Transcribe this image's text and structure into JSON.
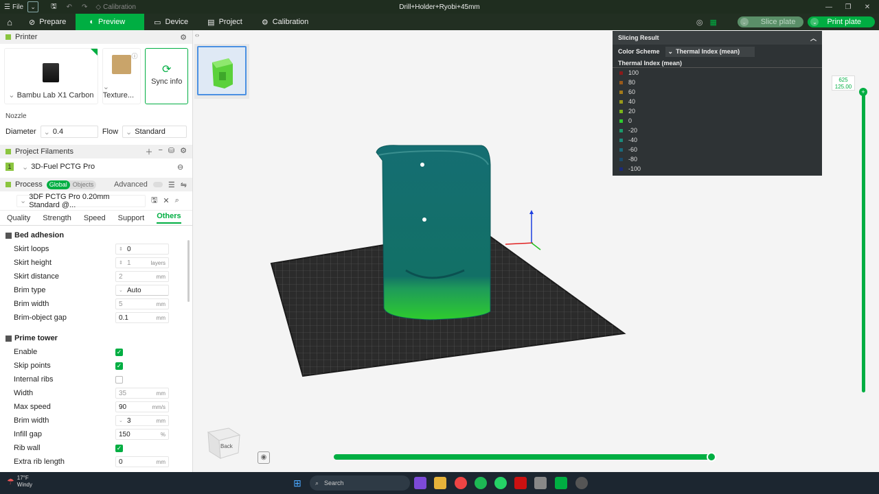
{
  "titlebar": {
    "file": "File",
    "breadcrumb": "Calibration",
    "title": "Drill+Holder+Ryobi+45mm"
  },
  "nav": {
    "tabs": [
      {
        "label": "Prepare"
      },
      {
        "label": "Preview"
      },
      {
        "label": "Device"
      },
      {
        "label": "Project"
      },
      {
        "label": "Calibration"
      }
    ],
    "slice_plate": "Slice plate",
    "print_plate": "Print plate"
  },
  "printer": {
    "section_title": "Printer",
    "printer_name": "Bambu Lab X1 Carbon",
    "plate_name": "Texture...",
    "sync_label": "Sync info",
    "nozzle_label": "Nozzle",
    "diameter_label": "Diameter",
    "diameter_value": "0.4",
    "flow_label": "Flow",
    "flow_value": "Standard"
  },
  "filaments": {
    "section_title": "Project Filaments",
    "items": [
      {
        "index": "1",
        "name": "3D-Fuel PCTG Pro",
        "color": "#8bc53f"
      }
    ]
  },
  "process": {
    "section_title": "Process",
    "toggle_global": "Global",
    "toggle_objects": "Objects",
    "advanced_label": "Advanced",
    "preset": "3DF PCTG Pro 0.20mm Standard @...",
    "tabs": [
      "Quality",
      "Strength",
      "Speed",
      "Support",
      "Others"
    ],
    "groups": [
      {
        "title": "Bed adhesion",
        "options": [
          {
            "label": "Skirt loops",
            "value": "0",
            "unit": "",
            "type": "spin"
          },
          {
            "label": "Skirt height",
            "value": "1",
            "unit": "layers",
            "type": "spin-dis"
          },
          {
            "label": "Skirt distance",
            "value": "2",
            "unit": "mm",
            "type": "dis"
          },
          {
            "label": "Brim type",
            "value": "Auto",
            "unit": "",
            "type": "select"
          },
          {
            "label": "Brim width",
            "value": "5",
            "unit": "mm",
            "type": "dis"
          },
          {
            "label": "Brim-object gap",
            "value": "0.1",
            "unit": "mm",
            "type": "text"
          }
        ]
      },
      {
        "title": "Prime tower",
        "options": [
          {
            "label": "Enable",
            "checked": true,
            "type": "check"
          },
          {
            "label": "Skip points",
            "checked": true,
            "type": "check"
          },
          {
            "label": "Internal ribs",
            "checked": false,
            "type": "check"
          },
          {
            "label": "Width",
            "value": "35",
            "unit": "mm",
            "type": "dis"
          },
          {
            "label": "Max speed",
            "value": "90",
            "unit": "mm/s",
            "type": "text"
          },
          {
            "label": "Brim width",
            "value": "3",
            "unit": "mm",
            "type": "select"
          },
          {
            "label": "Infill gap",
            "value": "150",
            "unit": "%",
            "type": "text"
          },
          {
            "label": "Rib wall",
            "checked": true,
            "type": "check"
          },
          {
            "label": "Extra rib length",
            "value": "0",
            "unit": "mm",
            "type": "text"
          }
        ]
      }
    ]
  },
  "slicing_result": {
    "title": "Slicing Result",
    "color_scheme_label": "Color Scheme",
    "color_scheme_value": "Thermal Index (mean)",
    "legend_title": "Thermal Index (mean)",
    "legend": [
      {
        "label": "100",
        "color": "#8b1a1a"
      },
      {
        "label": "80",
        "color": "#9a5a1a"
      },
      {
        "label": "60",
        "color": "#a47a1a"
      },
      {
        "label": "40",
        "color": "#9a9a1a"
      },
      {
        "label": "20",
        "color": "#7ab51a"
      },
      {
        "label": "0",
        "color": "#2ecc2e"
      },
      {
        "label": "-20",
        "color": "#1a9a6a"
      },
      {
        "label": "-40",
        "color": "#1a8a7a"
      },
      {
        "label": "-60",
        "color": "#1a6a7a"
      },
      {
        "label": "-80",
        "color": "#1a4a6a"
      },
      {
        "label": "-100",
        "color": "#1a2a7a"
      }
    ]
  },
  "layer_slider": {
    "top_label": "625",
    "top_height": "125.00"
  },
  "viewcube": {
    "face": "Back"
  },
  "taskbar": {
    "temp": "17°F",
    "weather": "Windy",
    "search_placeholder": "Search"
  },
  "colors": {
    "accent": "#00ae42",
    "model_top": "#0e6e6e",
    "model_bottom": "#2ecc2e"
  }
}
